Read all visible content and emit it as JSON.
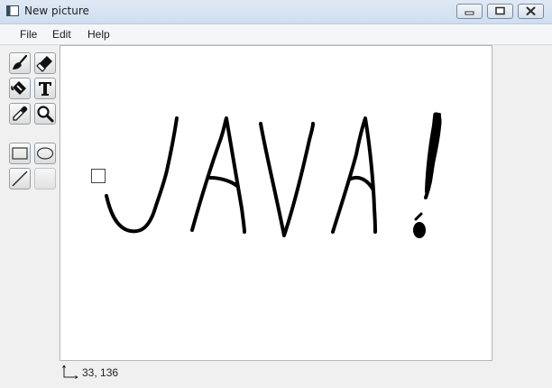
{
  "window": {
    "title": "New picture"
  },
  "menu": {
    "items": [
      {
        "label": "File"
      },
      {
        "label": "Edit"
      },
      {
        "label": "Help"
      }
    ]
  },
  "toolbox": {
    "tools": [
      {
        "icon": "paintbrush-icon"
      },
      {
        "icon": "eraser-icon"
      },
      {
        "icon": "paint-bucket-icon"
      },
      {
        "icon": "text-tool-icon"
      },
      {
        "icon": "eyedropper-icon"
      },
      {
        "icon": "magnifier-icon"
      },
      {
        "icon": "rectangle-icon"
      },
      {
        "icon": "ellipse-icon"
      },
      {
        "icon": "line-icon"
      },
      {
        "icon": "empty-tool"
      }
    ]
  },
  "canvas": {
    "background": "#ffffff",
    "stroke_color": "#000000"
  },
  "status": {
    "coordinates": "33, 136"
  }
}
